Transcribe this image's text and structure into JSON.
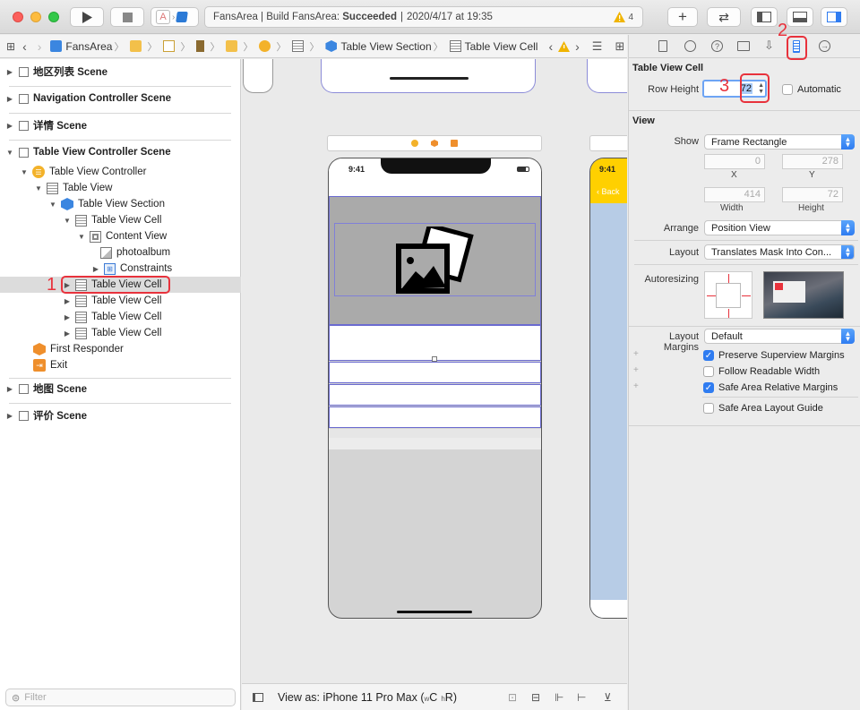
{
  "toolbar": {
    "scheme_app": "FansArea",
    "status_prefix": "FansArea | Build FansArea: ",
    "status_result": "Succeeded",
    "status_time": "2020/4/17 at 19:35",
    "warning_count": "4"
  },
  "jumpbar": {
    "items": [
      "FansArea",
      "",
      "",
      "",
      "",
      "",
      "",
      "Table View Section",
      "Table View Cell"
    ]
  },
  "navigator": {
    "rows": [
      {
        "label": "地区列表 Scene",
        "kind": "scene"
      },
      {
        "label": "Navigation Controller Scene",
        "kind": "scene"
      },
      {
        "label": "详情 Scene",
        "kind": "scene"
      },
      {
        "label": "Table View Controller Scene",
        "kind": "scene"
      },
      {
        "label": "Table View Controller"
      },
      {
        "label": "Table View"
      },
      {
        "label": "Table View Section"
      },
      {
        "label": "Table View Cell"
      },
      {
        "label": "Content View"
      },
      {
        "label": "photoalbum"
      },
      {
        "label": "Constraints"
      },
      {
        "label": "Table View Cell"
      },
      {
        "label": "Table View Cell"
      },
      {
        "label": "Table View Cell"
      },
      {
        "label": "Table View Cell"
      },
      {
        "label": "First Responder"
      },
      {
        "label": "Exit"
      },
      {
        "label": "地图 Scene",
        "kind": "scene"
      },
      {
        "label": "评价 Scene",
        "kind": "scene"
      }
    ],
    "filter_placeholder": "Filter"
  },
  "canvas": {
    "phone_time": "9:41",
    "phone2_time": "9:41",
    "back_label": "Back",
    "view_as": "View as: iPhone 11 Pro Max (",
    "size_w": "w",
    "size_c": "C",
    "size_h": "h",
    "size_r": "R",
    "view_as_close": ")"
  },
  "annotations": {
    "one": "1",
    "two": "2",
    "three": "3"
  },
  "inspector": {
    "cell_section_title": "Table View Cell",
    "row_height_label": "Row Height",
    "row_height_value": "72",
    "automatic_label": "Automatic",
    "view_section_title": "View",
    "show_label": "Show",
    "show_value": "Frame Rectangle",
    "x_value": "0",
    "y_value": "278",
    "x_label": "X",
    "y_label": "Y",
    "width_value": "414",
    "height_value": "72",
    "width_label": "Width",
    "height_label": "Height",
    "arrange_label": "Arrange",
    "arrange_value": "Position View",
    "layout_label": "Layout",
    "layout_value": "Translates Mask Into Con...",
    "autoresizing_label": "Autoresizing",
    "margins_label": "Layout Margins",
    "margins_value": "Default",
    "checks": [
      {
        "label": "Preserve Superview Margins",
        "checked": true
      },
      {
        "label": "Follow Readable Width",
        "checked": false
      },
      {
        "label": "Safe Area Relative Margins",
        "checked": true
      },
      {
        "label": "Safe Area Layout Guide",
        "checked": false
      }
    ]
  },
  "colors": {
    "accent": "#2f7cf1",
    "annotation": "#e8323c",
    "warning": "#f0b400"
  }
}
